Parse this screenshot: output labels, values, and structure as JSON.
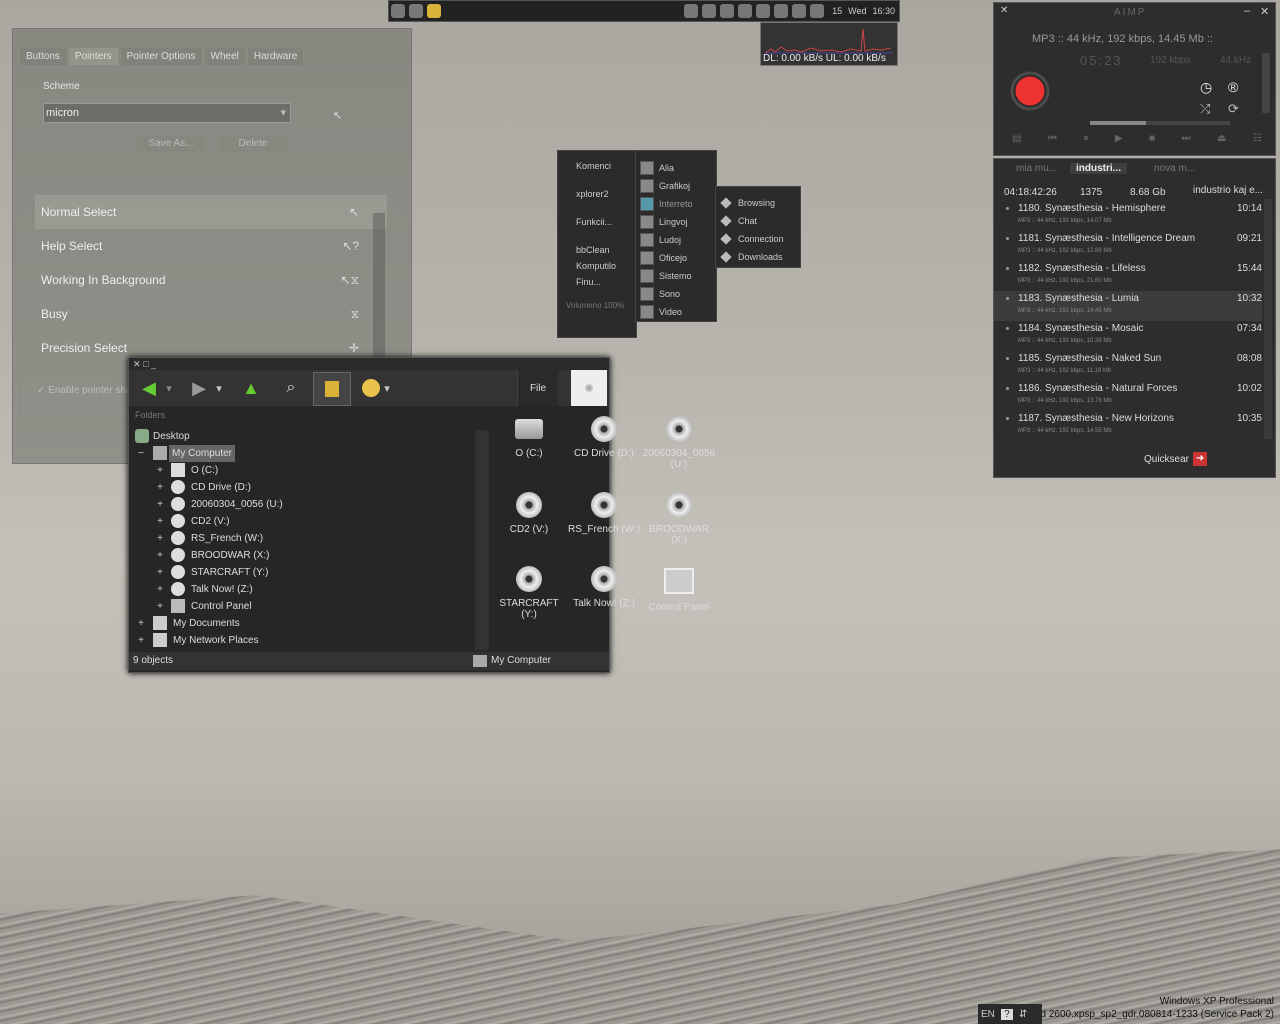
{
  "topbar": {
    "date": "15",
    "day": "Wed",
    "time": "16:30"
  },
  "netmeter": {
    "text": "DL: 0.00 kB/s UL: 0.00 kB/s"
  },
  "mouse_dialog": {
    "tabs": [
      "Buttons",
      "Pointers",
      "Pointer Options",
      "Wheel",
      "Hardware"
    ],
    "scheme_label": "Scheme",
    "scheme_value": "micron",
    "save_as": "Save As...",
    "delete": "Delete",
    "pointers": [
      {
        "name": "Normal Select",
        "cursor": "↖"
      },
      {
        "name": "Help Select",
        "cursor": "↖?"
      },
      {
        "name": "Working In Background",
        "cursor": "↖⧖"
      },
      {
        "name": "Busy",
        "cursor": "⧖"
      },
      {
        "name": "Precision Select",
        "cursor": "✛"
      }
    ],
    "enable_shadow": "Enable pointer sha"
  },
  "startmenu": {
    "col1": [
      "Komenci",
      "xplorer2",
      "Funkcii...",
      "bbClean",
      "Komputilo",
      "Finu..."
    ],
    "volume": "Volumeno 100%",
    "col2": [
      "Alia",
      "Grafikoj",
      "Interreto",
      "Lingvoj",
      "Ludoj",
      "Oficejo",
      "Sistemo",
      "Sono",
      "Video"
    ],
    "col3": [
      "Browsing",
      "Chat",
      "Connection",
      "Downloads"
    ]
  },
  "explorer": {
    "toolbar_file": "File",
    "folders_label": "Folders",
    "tree": [
      {
        "label": "Desktop",
        "level": 0,
        "pm": ""
      },
      {
        "label": "My Computer",
        "level": 1,
        "pm": "−"
      },
      {
        "label": "O (C:)",
        "level": 2,
        "pm": "+"
      },
      {
        "label": "CD Drive (D:)",
        "level": 2,
        "pm": "+"
      },
      {
        "label": "20060304_0056 (U:)",
        "level": 2,
        "pm": "+"
      },
      {
        "label": "CD2 (V:)",
        "level": 2,
        "pm": "+"
      },
      {
        "label": "RS_French (W:)",
        "level": 2,
        "pm": "+"
      },
      {
        "label": "BROODWAR (X:)",
        "level": 2,
        "pm": "+"
      },
      {
        "label": "STARCRAFT (Y:)",
        "level": 2,
        "pm": "+"
      },
      {
        "label": "Talk Now! (Z:)",
        "level": 2,
        "pm": "+"
      },
      {
        "label": "Control Panel",
        "level": 2,
        "pm": "+"
      },
      {
        "label": "My Documents",
        "level": 1,
        "pm": "+"
      },
      {
        "label": "My Network Places",
        "level": 1,
        "pm": "+"
      }
    ],
    "items": [
      {
        "label": "O (C:)",
        "type": "hdd"
      },
      {
        "label": "CD Drive (D:)",
        "type": "disc"
      },
      {
        "label": "20060304_0056 (U:)",
        "type": "disc"
      },
      {
        "label": "CD2 (V:)",
        "type": "disc"
      },
      {
        "label": "RS_French (W:)",
        "type": "disc"
      },
      {
        "label": "BROODWAR (X:)",
        "type": "disc"
      },
      {
        "label": "STARCRAFT (Y:)",
        "type": "disc"
      },
      {
        "label": "Talk Now! (Z:)",
        "type": "disc"
      },
      {
        "label": "Control Panel",
        "type": "cpl"
      }
    ],
    "status_count": "9 objects",
    "status_location": "My Computer"
  },
  "aimp": {
    "title": "AIMP",
    "info": "MP3 :: 44 kHz, 192 kbps, 14.45 Mb ::",
    "time": "05:23",
    "kbps": "192 kbps",
    "khz": "44 kHz"
  },
  "playlist": {
    "tabs": [
      "mia mu...",
      "industri...",
      "nova m..."
    ],
    "total_time": "04:18:42:26",
    "count": "1375",
    "size": "8.68 Gb",
    "name": "industrio kaj e...",
    "tracks": [
      {
        "title": "1180. Synæsthesia - Hemisphere",
        "dur": "10:14",
        "info": "MP3 :: 44 kHz, 192 kbps, 14.07 Mb"
      },
      {
        "title": "1181. Synæsthesia - Intelligence Dream",
        "dur": "09:21",
        "info": "MP3 :: 44 kHz, 192 kbps, 12.86 Mb"
      },
      {
        "title": "1182. Synæsthesia - Lifeless",
        "dur": "15:44",
        "info": "MP3 :: 44 kHz, 192 kbps, 21.60 Mb"
      },
      {
        "title": "1183. Synæsthesia - Lumia",
        "dur": "10:32",
        "info": "MP3 :: 44 kHz, 192 kbps, 14.45 Mb"
      },
      {
        "title": "1184. Synæsthesia - Mosaic",
        "dur": "07:34",
        "info": "MP3 :: 44 kHz, 192 kbps, 10.38 Mb"
      },
      {
        "title": "1185. Synæsthesia - Naked Sun",
        "dur": "08:08",
        "info": "MP3 :: 44 kHz, 192 kbps, 11.19 Mb"
      },
      {
        "title": "1186. Synæsthesia - Natural Forces",
        "dur": "10:02",
        "info": "MP3 :: 44 kHz, 192 kbps, 13.78 Mb"
      },
      {
        "title": "1187. Synæsthesia - New Horizons",
        "dur": "10:35",
        "info": "MP3 :: 44 kHz, 192 kbps, 14.55 Mb"
      }
    ],
    "quicksearch": "Quicksear"
  },
  "tray": {
    "lang": "EN"
  },
  "winver": {
    "line1": "Windows XP Professional",
    "line2": "Build 2600.xpsp_sp2_gdr.080814-1233 (Service Pack 2)"
  }
}
